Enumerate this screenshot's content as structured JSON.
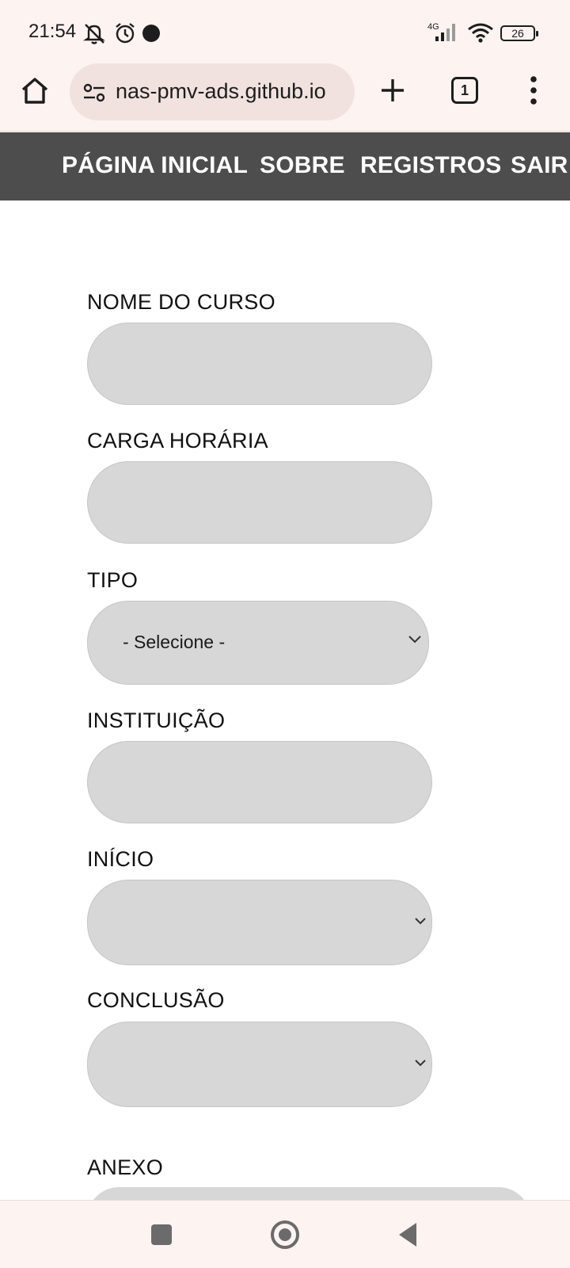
{
  "status_bar": {
    "time": "21:54",
    "network": "4G",
    "battery": "26"
  },
  "browser": {
    "url": "nas-pmv-ads.github.io",
    "tab_count": "1"
  },
  "nav": {
    "home": "PÁGINA INICIAL",
    "sobre": "SOBRE",
    "registros": "REGISTROS",
    "sair": "SAIR"
  },
  "form": {
    "nome_label": "NOME DO CURSO",
    "carga_label": "CARGA HORÁRIA",
    "tipo_label": "TIPO",
    "tipo_selected": "- Selecione -",
    "instituicao_label": "INSTITUIÇÃO",
    "inicio_label": "INÍCIO",
    "conclusao_label": "CONCLUSÃO",
    "anexo_label": "ANEXO"
  }
}
